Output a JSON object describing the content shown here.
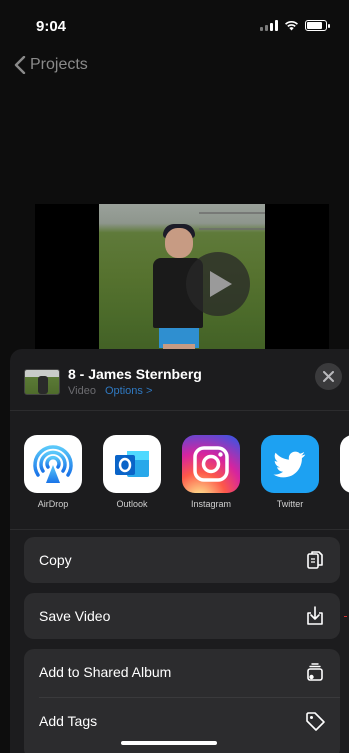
{
  "status": {
    "time": "9:04",
    "battery_level": 0.85
  },
  "nav": {
    "back_label": "Projects"
  },
  "share": {
    "title": "8 - James Sternberg",
    "subtitle_type": "Video",
    "options_label": "Options >"
  },
  "apps": [
    {
      "label": "AirDrop",
      "icon": "airdrop-icon"
    },
    {
      "label": "Outlook",
      "icon": "outlook-icon"
    },
    {
      "label": "Instagram",
      "icon": "instagram-icon"
    },
    {
      "label": "Twitter",
      "icon": "twitter-icon"
    }
  ],
  "actions": [
    {
      "label": "Copy",
      "icon": "copy-icon"
    },
    {
      "label": "Save Video",
      "icon": "save-icon"
    },
    {
      "label": "Add to Shared Album",
      "icon": "shared-album-icon"
    },
    {
      "label": "Add Tags",
      "icon": "tag-icon"
    }
  ],
  "colors": {
    "background": "#0d0d0d",
    "sheet": "#1c1c1e",
    "row": "#2c2c2e",
    "link": "#2f79c2"
  }
}
